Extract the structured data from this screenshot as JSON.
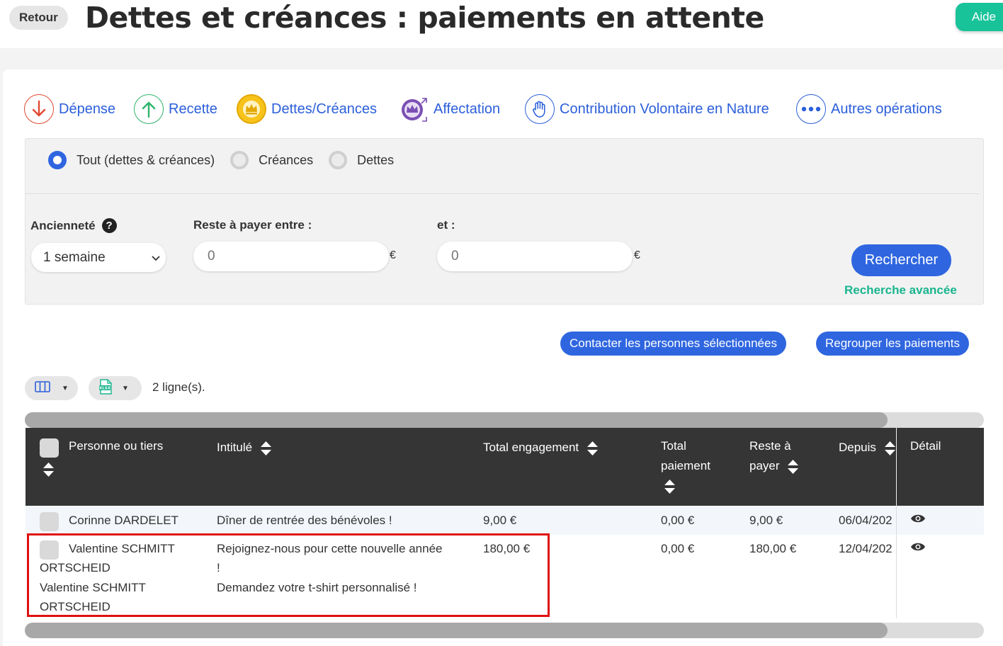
{
  "header": {
    "back_label": "Retour",
    "title": "Dettes et créances : paiements en attente",
    "help_label": "Aide"
  },
  "operations": [
    {
      "label": "Dépense",
      "icon": "arrow-down-icon",
      "color": "#e0492f"
    },
    {
      "label": "Recette",
      "icon": "arrow-up-icon",
      "color": "#2fb36b"
    },
    {
      "label": "Dettes/Créances",
      "icon": "crown-icon",
      "color": "#f0b400"
    },
    {
      "label": "Affectation",
      "icon": "crown-shuffle-icon",
      "color": "#7a4fb3"
    },
    {
      "label": "Contribution Volontaire en Nature",
      "icon": "hand-icon",
      "color": "#2b5fd9"
    },
    {
      "label": "Autres opérations",
      "icon": "more-dots-icon",
      "color": "#2b5fd9"
    }
  ],
  "filters": {
    "radios": [
      {
        "label": "Tout (dettes & créances)",
        "selected": true
      },
      {
        "label": "Créances",
        "selected": false
      },
      {
        "label": "Dettes",
        "selected": false
      }
    ],
    "seniority_label": "Ancienneté",
    "seniority_value": "1 semaine",
    "remaining_between_label": "Reste à payer entre :",
    "and_label": "et :",
    "min_placeholder": "0",
    "max_placeholder": "0",
    "currency": "€",
    "search_label": "Rechercher",
    "advanced_search_label": "Recherche avancée"
  },
  "actions": {
    "contact_label": "Contacter les personnes sélectionnées",
    "group_label": "Regrouper les paiements"
  },
  "table_tools": {
    "row_count": "2 ligne(s)."
  },
  "table": {
    "columns": {
      "person": "Personne ou tiers",
      "label": "Intitulé",
      "total_commitment": "Total engagement",
      "total_payment_1": "Total",
      "total_payment_2": "paiement",
      "remaining_1": "Reste à",
      "remaining_2": "payer",
      "since": "Depuis",
      "detail": "Détail"
    },
    "rows": [
      {
        "person": "Corinne DARDELET",
        "label": "Dîner de rentrée des bénévoles !",
        "total_commitment": "9,00 €",
        "total_payment": "0,00 €",
        "remaining": "9,00 €",
        "since": "06/04/202"
      },
      {
        "person_1": "Valentine SCHMITT",
        "person_2": "ORTSCHEID",
        "person_3": "Valentine SCHMITT",
        "person_4": "ORTSCHEID",
        "label_1": "Rejoignez-nous pour cette nouvelle année",
        "label_2": "!",
        "label_3": "Demandez votre t-shirt personnalisé !",
        "total_commitment": "180,00 €",
        "total_payment": "0,00 €",
        "remaining": "180,00 €",
        "since": "12/04/202"
      }
    ]
  }
}
